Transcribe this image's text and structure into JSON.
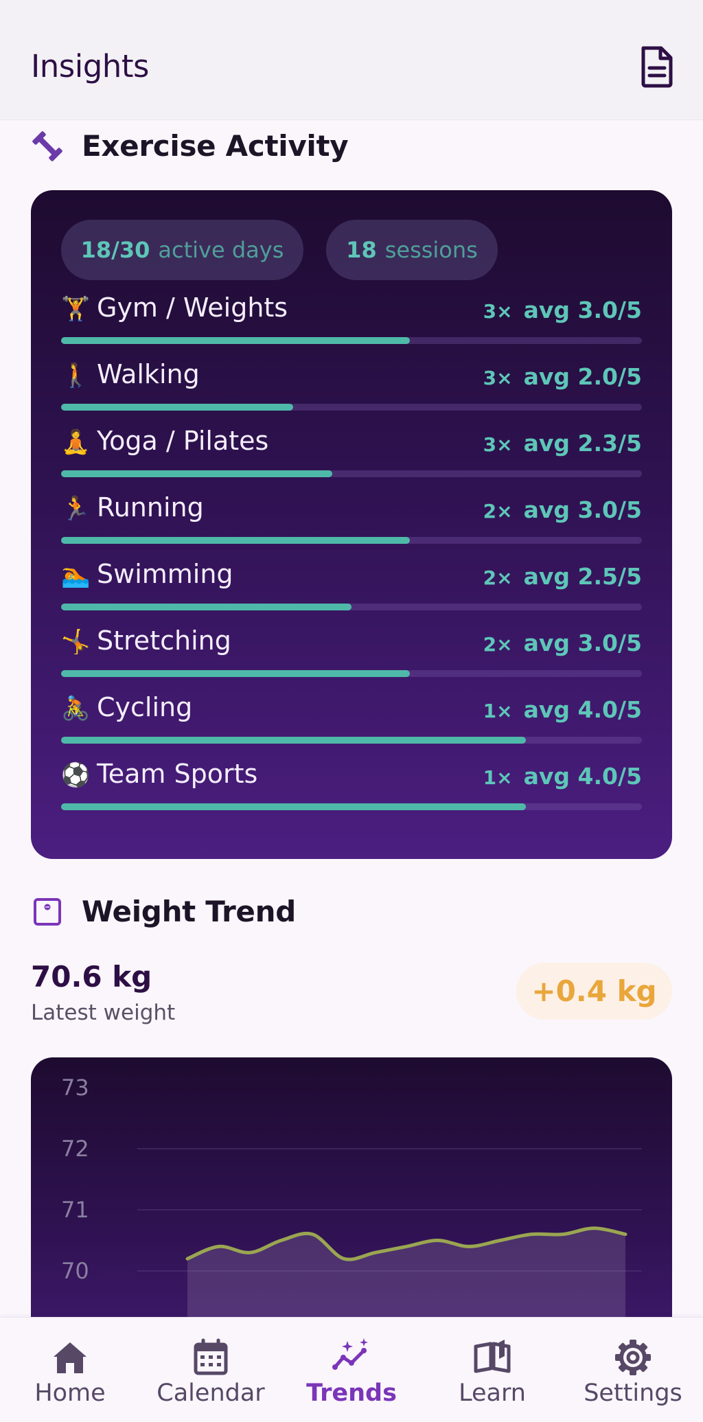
{
  "header": {
    "title": "Insights",
    "report_icon": "document-icon"
  },
  "exercise": {
    "section_title": "Exercise Activity",
    "section_icon": "dumbbell-icon",
    "active_days_value": "18/30",
    "active_days_unit": "active days",
    "sessions_value": "18",
    "sessions_unit": "sessions",
    "activities": [
      {
        "emoji": "🏋",
        "name": "Gym / Weights",
        "count": "3×",
        "avg": "avg 3.0/5",
        "fill": 0.6
      },
      {
        "emoji": "🚶",
        "name": "Walking",
        "count": "3×",
        "avg": "avg 2.0/5",
        "fill": 0.4
      },
      {
        "emoji": "🧘",
        "name": "Yoga / Pilates",
        "count": "3×",
        "avg": "avg 2.3/5",
        "fill": 0.467
      },
      {
        "emoji": "🏃",
        "name": "Running",
        "count": "2×",
        "avg": "avg 3.0/5",
        "fill": 0.6
      },
      {
        "emoji": "🏊",
        "name": "Swimming",
        "count": "2×",
        "avg": "avg 2.5/5",
        "fill": 0.5
      },
      {
        "emoji": "🤸",
        "name": "Stretching",
        "count": "2×",
        "avg": "avg 3.0/5",
        "fill": 0.6
      },
      {
        "emoji": "🚴",
        "name": "Cycling",
        "count": "1×",
        "avg": "avg 4.0/5",
        "fill": 0.8
      },
      {
        "emoji": "⚽",
        "name": "Team Sports",
        "count": "1×",
        "avg": "avg 4.0/5",
        "fill": 0.8
      }
    ]
  },
  "weight": {
    "section_title": "Weight Trend",
    "section_icon": "scale-icon",
    "latest_value": "70.6 kg",
    "latest_label": "Latest weight",
    "delta": "+0.4 kg"
  },
  "chart_data": {
    "type": "area",
    "title": "",
    "xlabel": "",
    "ylabel": "",
    "ylim": [
      69.6,
      73
    ],
    "yticks": [
      73,
      72,
      71,
      70
    ],
    "grid": true,
    "series": [
      {
        "values": [
          70.2,
          70.4,
          70.3,
          70.5,
          70.6,
          70.2,
          70.3,
          70.4,
          70.5,
          70.4,
          70.5,
          70.6,
          70.6,
          70.7,
          70.6
        ]
      }
    ]
  },
  "nav": {
    "items": [
      {
        "label": "Home",
        "icon": "home-icon"
      },
      {
        "label": "Calendar",
        "icon": "calendar-icon"
      },
      {
        "label": "Trends",
        "icon": "trends-icon"
      },
      {
        "label": "Learn",
        "icon": "book-icon"
      },
      {
        "label": "Settings",
        "icon": "gear-icon"
      }
    ],
    "active": "Trends"
  },
  "colors": {
    "accent": "#7b35b8",
    "teal": "#4fb9a9",
    "chart_line": "#9aa651",
    "delta": "#e9a63b"
  }
}
